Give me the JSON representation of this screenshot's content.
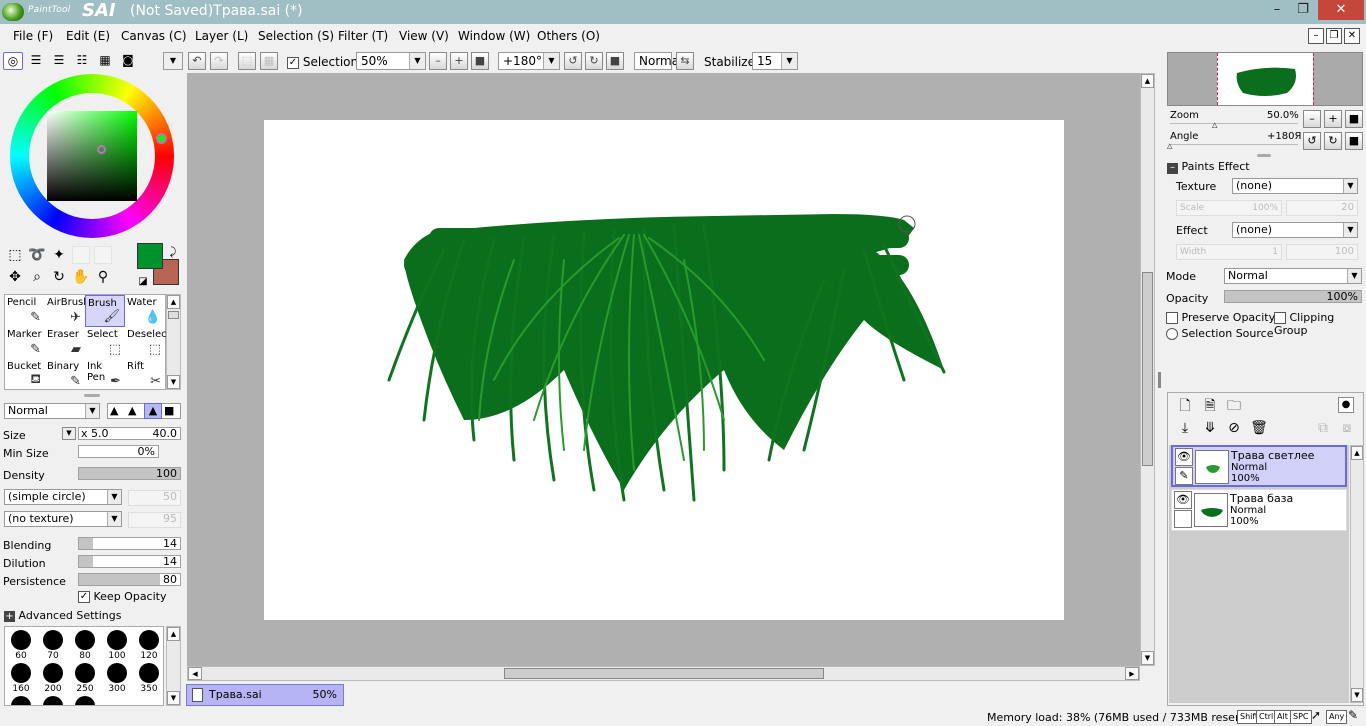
{
  "app": {
    "logo_small": "PaintTool",
    "logo_big": "SAI",
    "window_title": "(Not Saved)Трава.sai (*)"
  },
  "window_controls": {
    "minimize": "–",
    "maximize": "❐",
    "close": "✕"
  },
  "menu": [
    "File (F)",
    "Edit (E)",
    "Canvas (C)",
    "Layer (L)",
    "Selection (S)",
    "Filter (T)",
    "View (V)",
    "Window (W)",
    "Others (O)"
  ],
  "toolbar": {
    "selection_label": "Selection",
    "selection_checked": "✓",
    "zoom": "50%",
    "rotation": "+180°",
    "blend_mode": "Normal",
    "stabilizer_label": "Stabilizer",
    "stabilizer": "15"
  },
  "tools": [
    {
      "label": "Pencil",
      "icon": "✎"
    },
    {
      "label": "AirBrush",
      "icon": "✈"
    },
    {
      "label": "Brush",
      "icon": "🖌"
    },
    {
      "label": "Water",
      "icon": "💧"
    },
    {
      "label": "Marker",
      "icon": "✎"
    },
    {
      "label": "Eraser",
      "icon": "▰"
    },
    {
      "label": "Select",
      "icon": "⬚"
    },
    {
      "label": "Deselect",
      "icon": "⬚"
    },
    {
      "label": "Bucket",
      "icon": "⛾"
    },
    {
      "label": "Binary",
      "icon": "✎"
    },
    {
      "label": "Ink Pen",
      "icon": "✒"
    },
    {
      "label": "Rift",
      "icon": "✂"
    }
  ],
  "brush": {
    "mode": "Normal",
    "size_label": "Size",
    "size_multiplier": "x 5.0",
    "size_value": "40.0",
    "min_size_label": "Min Size",
    "min_size": "0%",
    "min_size_fill": 0,
    "density_label": "Density",
    "density": "100",
    "density_fill": 1.0,
    "shape": "(simple circle)",
    "shape_value": "50",
    "texture": "(no texture)",
    "texture_value": "95",
    "blending_label": "Blending",
    "blending": "14",
    "blending_fill": 0.14,
    "dilution_label": "Dilution",
    "dilution": "14",
    "dilution_fill": 0.14,
    "persistence_label": "Persistence",
    "persistence": "80",
    "persistence_fill": 0.8,
    "keep_opacity_label": "Keep Opacity",
    "keep_opacity": "✓",
    "advanced": "Advanced Settings",
    "sizes": [
      "60",
      "70",
      "80",
      "100",
      "120",
      "160",
      "200",
      "250",
      "300",
      "350"
    ]
  },
  "navigator": {
    "zoom_label": "Zoom",
    "zoom": "50.0%",
    "angle_label": "Angle",
    "angle": "+180Я"
  },
  "paint_effects": {
    "title": "Paints Effect",
    "texture_label": "Texture",
    "texture": "(none)",
    "scale_label": "Scale",
    "scale": "100%",
    "scale_value": "20",
    "effect_label": "Effect",
    "effect": "(none)",
    "width_label": "Width",
    "width": "1",
    "width_value": "100"
  },
  "layer_props": {
    "mode_label": "Mode",
    "mode": "Normal",
    "opacity_label": "Opacity",
    "opacity": "100%",
    "preserve_opacity": "Preserve Opacity",
    "clipping_group": "Clipping Group",
    "selection_source": "Selection Source"
  },
  "layers": [
    {
      "name": "Трава светлее",
      "mode": "Normal",
      "opacity": "100%"
    },
    {
      "name": "Трава база",
      "mode": "Normal",
      "opacity": "100%"
    }
  ],
  "document_tab": {
    "name": "Трава.sai",
    "zoom": "50%"
  },
  "status": {
    "memory": "Memory load: 38% (76MB used / 733MB reserved)",
    "keys": [
      "Shift",
      "Ctrl",
      "Alt",
      "SPC",
      "Any"
    ]
  },
  "colors": {
    "primary": "#00922c",
    "secondary": "#b86454",
    "grass_dark": "#0b6e1c",
    "grass_light": "#2a9a2e",
    "selection": "#6a6adc"
  }
}
